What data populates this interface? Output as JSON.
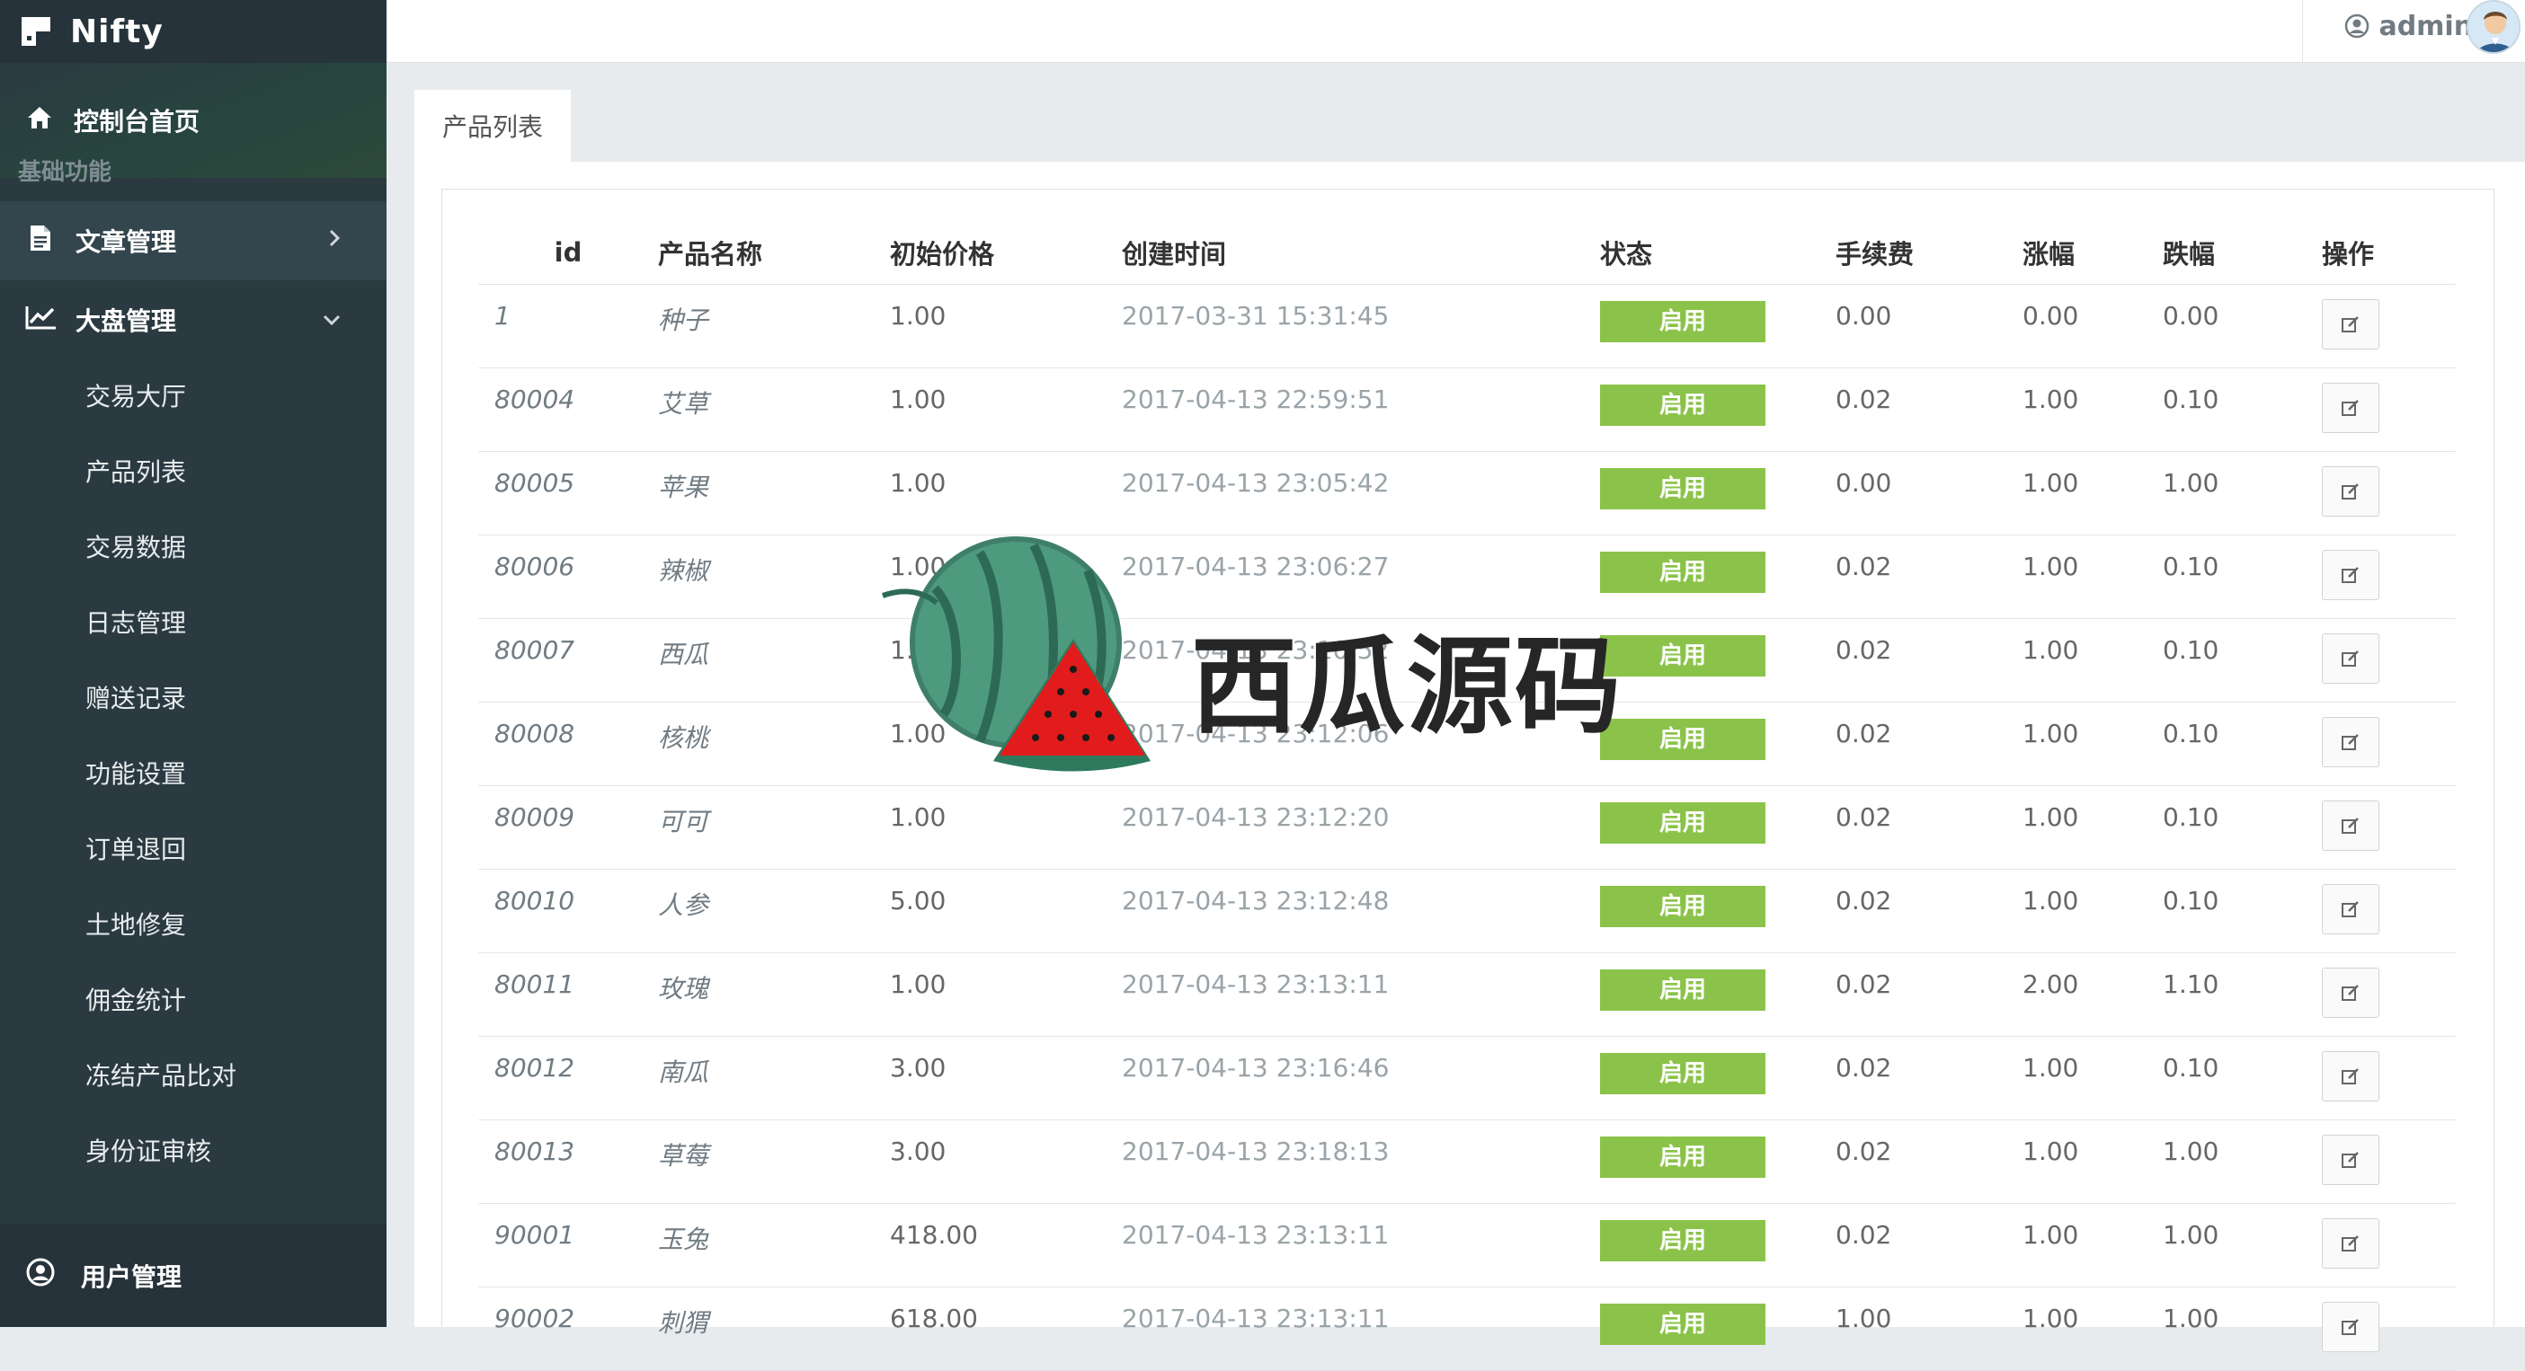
{
  "brand": {
    "name": "Nifty"
  },
  "sidebar": {
    "home": "控制台首页",
    "category": "基础功能",
    "groups": [
      {
        "label": "文章管理"
      },
      {
        "label": "大盘管理"
      }
    ],
    "sub_items": [
      "交易大厅",
      "产品列表",
      "交易数据",
      "日志管理",
      "赠送记录",
      "功能设置",
      "订单退回",
      "土地修复",
      "佣金统计",
      "冻结产品比对",
      "身份证审核"
    ],
    "bottom": "用户管理"
  },
  "header": {
    "user": "admin"
  },
  "tab": {
    "label": "产品列表"
  },
  "table": {
    "columns": [
      "id",
      "产品名称",
      "初始价格",
      "创建时间",
      "状态",
      "手续费",
      "涨幅",
      "跌幅",
      "操作"
    ],
    "rows": [
      [
        "1",
        "种子",
        "1.00",
        "2017-03-31 15:31:45",
        "启用",
        "0.00",
        "0.00",
        "0.00"
      ],
      [
        "80004",
        "艾草",
        "1.00",
        "2017-04-13 22:59:51",
        "启用",
        "0.02",
        "1.00",
        "0.10"
      ],
      [
        "80005",
        "苹果",
        "1.00",
        "2017-04-13 23:05:42",
        "启用",
        "0.00",
        "1.00",
        "1.00"
      ],
      [
        "80006",
        "辣椒",
        "1.00",
        "2017-04-13 23:06:27",
        "启用",
        "0.02",
        "1.00",
        "0.10"
      ],
      [
        "80007",
        "西瓜",
        "1.00",
        "2017-04-13 23:10:52",
        "启用",
        "0.02",
        "1.00",
        "0.10"
      ],
      [
        "80008",
        "核桃",
        "1.00",
        "2017-04-13 23:12:06",
        "启用",
        "0.02",
        "1.00",
        "0.10"
      ],
      [
        "80009",
        "可可",
        "1.00",
        "2017-04-13 23:12:20",
        "启用",
        "0.02",
        "1.00",
        "0.10"
      ],
      [
        "80010",
        "人参",
        "5.00",
        "2017-04-13 23:12:48",
        "启用",
        "0.02",
        "1.00",
        "0.10"
      ],
      [
        "80011",
        "玫瑰",
        "1.00",
        "2017-04-13 23:13:11",
        "启用",
        "0.02",
        "2.00",
        "1.10"
      ],
      [
        "80012",
        "南瓜",
        "3.00",
        "2017-04-13 23:16:46",
        "启用",
        "0.02",
        "1.00",
        "0.10"
      ],
      [
        "80013",
        "草莓",
        "3.00",
        "2017-04-13 23:18:13",
        "启用",
        "0.02",
        "1.00",
        "1.00"
      ],
      [
        "90001",
        "玉兔",
        "418.00",
        "2017-04-13 23:13:11",
        "启用",
        "0.02",
        "1.00",
        "1.00"
      ],
      [
        "90002",
        "刺猬",
        "618.00",
        "2017-04-13 23:13:11",
        "启用",
        "1.00",
        "1.00",
        "1.00"
      ]
    ]
  },
  "watermark": {
    "text": "西瓜源码"
  },
  "colors": {
    "sidebar": "#2b3a41",
    "status_on": "#8bc34a"
  },
  "icons": {
    "home": "home-icon",
    "article": "document-icon",
    "market": "line-chart-icon",
    "user": "user-circle-icon",
    "edit": "edit-icon"
  }
}
